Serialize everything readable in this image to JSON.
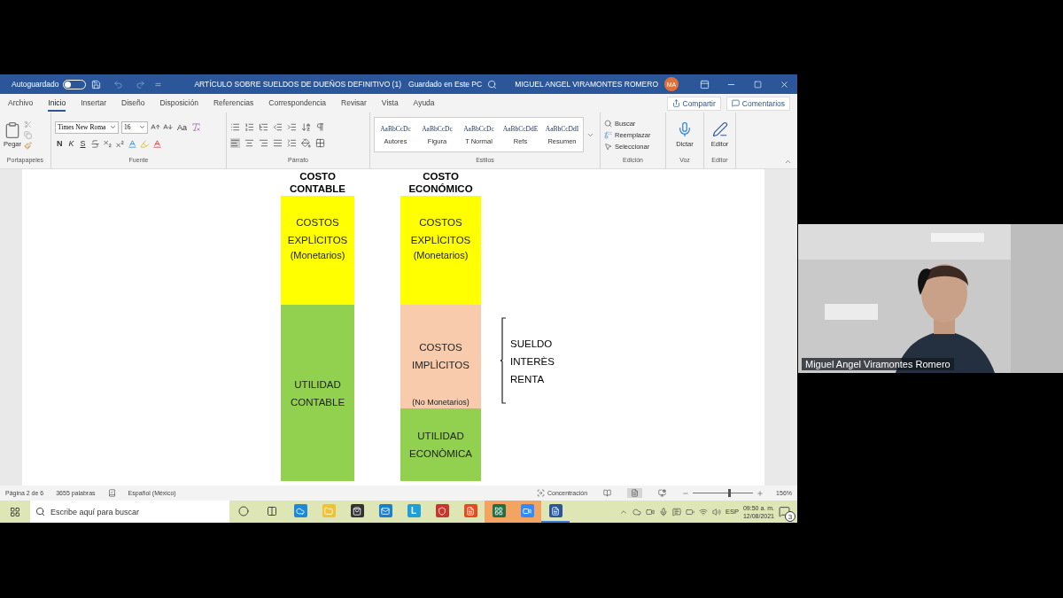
{
  "title_bar": {
    "autosave": {
      "label": "Autoguardado",
      "on": false
    },
    "document_title": "ARTÍCULO SOBRE SUELDOS DE DUEÑOS DEFINITIVO (1)",
    "save_status": "Guardado en Este PC",
    "user_name": "MIGUEL ANGEL VIRAMONTES ROMERO",
    "user_initials": "MA"
  },
  "menu_tabs": [
    {
      "label": "Archivo",
      "selected": false
    },
    {
      "label": "Inicio",
      "selected": true
    },
    {
      "label": "Insertar",
      "selected": false
    },
    {
      "label": "Diseño",
      "selected": false
    },
    {
      "label": "Disposición",
      "selected": false
    },
    {
      "label": "Referencias",
      "selected": false
    },
    {
      "label": "Correspondencia",
      "selected": false
    },
    {
      "label": "Revisar",
      "selected": false
    },
    {
      "label": "Vista",
      "selected": false
    },
    {
      "label": "Ayuda",
      "selected": false
    }
  ],
  "share_button": "Compartir",
  "comments_button": "Comentarios",
  "ribbon": {
    "clipboard": {
      "paste": "Pegar",
      "group": "Portapapeles"
    },
    "font": {
      "name": "Times New Roma",
      "size": "16",
      "bold": "N",
      "italic": "K",
      "underline": "S",
      "case": "Aa",
      "group": "Fuente"
    },
    "paragraph": {
      "group": "Párrafo"
    },
    "styles": {
      "group": "Estilos",
      "items": [
        {
          "preview": "AaBbCcDc",
          "name": "Autores"
        },
        {
          "preview": "AaBbCcDc",
          "name": "Figura"
        },
        {
          "preview": "AaBbCcDc",
          "name": "T Normal"
        },
        {
          "preview": "AaBbCcDdE",
          "name": "Refs"
        },
        {
          "preview": "AaBbCcDdI",
          "name": "Resumen"
        }
      ]
    },
    "editing": {
      "find": "Buscar",
      "replace": "Reemplazar",
      "select": "Seleccionar",
      "group": "Edición"
    },
    "voice": {
      "dictate": "Dictar",
      "group": "Voz"
    },
    "editor": {
      "label": "Editor",
      "group": "Editor"
    }
  },
  "document": {
    "columns": [
      {
        "heading": "COSTO CONTABLE",
        "segments": [
          {
            "kind": "explicit",
            "color": "#ffff00",
            "text": "COSTOS EXPLÌCITOS",
            "note": "(Monetarios)"
          },
          {
            "kind": "profit",
            "color": "#92d050",
            "text": "UTILIDAD CONTABLE"
          }
        ]
      },
      {
        "heading": "COSTO ECONÓMICO",
        "segments": [
          {
            "kind": "explicit",
            "color": "#ffff00",
            "text": "COSTOS EXPLÌCITOS",
            "note": "(Monetarios)"
          },
          {
            "kind": "implicit",
            "color": "#f8cbad",
            "text": "COSTOS IMPLÌCITOS",
            "note": "(No Monetarios)"
          },
          {
            "kind": "profit",
            "color": "#92d050",
            "text": "UTILIDAD ECONÒMICA"
          }
        ]
      }
    ],
    "bracket_items": [
      "SUELDO",
      "INTERÈS",
      "RENTA"
    ]
  },
  "status_bar": {
    "page": "Página 2 de 6",
    "words": "3655 palabras",
    "language": "Español (México)",
    "focus": "Concentración",
    "zoom": {
      "level": 0.6,
      "reading": "156%"
    }
  },
  "taskbar": {
    "search_placeholder": "Escribe aquí para buscar",
    "apps": [
      {
        "kind": "edge",
        "highlighted": false,
        "active": false
      },
      {
        "kind": "explorer",
        "highlighted": false,
        "active": false
      },
      {
        "kind": "store",
        "highlighted": false,
        "active": false
      },
      {
        "kind": "mail",
        "highlighted": false,
        "active": false
      },
      {
        "kind": "lync",
        "label": "L",
        "highlighted": false,
        "active": false
      },
      {
        "kind": "shield",
        "highlighted": false,
        "active": false
      },
      {
        "kind": "office",
        "highlighted": false,
        "active": false
      },
      {
        "kind": "excel",
        "highlighted": true,
        "active": false
      },
      {
        "kind": "zoom",
        "highlighted": true,
        "active": false
      },
      {
        "kind": "word",
        "highlighted": false,
        "active": true
      }
    ],
    "language": "ESP",
    "time": "09:50 a. m.",
    "date": "12/08/2021",
    "notifications": "3"
  },
  "webcam": {
    "kind": "picture",
    "name": "Miguel Angel Viramontes Romero"
  }
}
